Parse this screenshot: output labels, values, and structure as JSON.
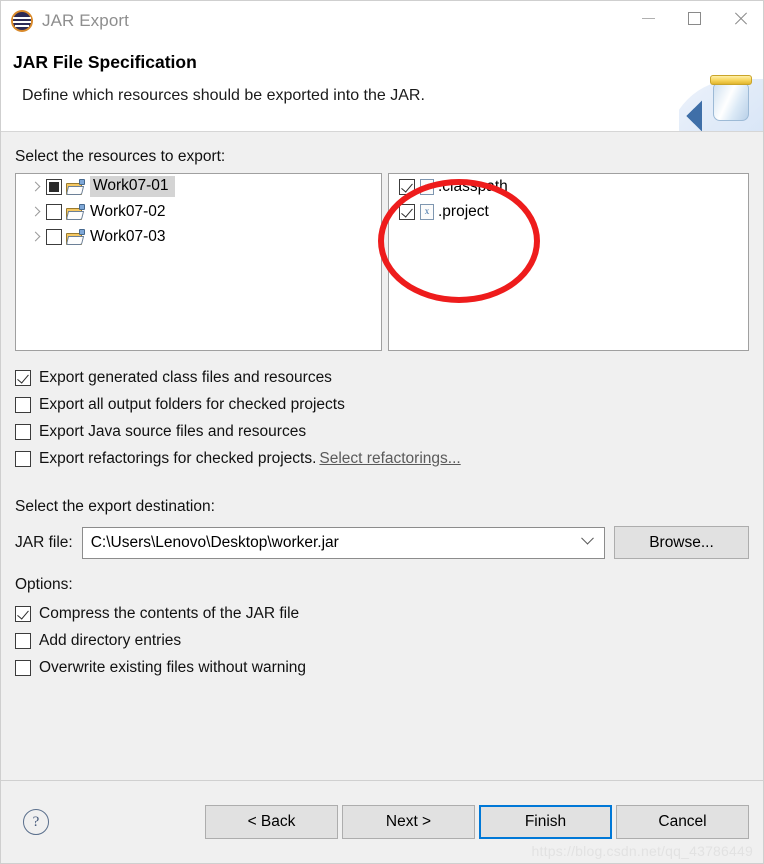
{
  "window": {
    "title": "JAR Export",
    "app_icon": "eclipse-icon",
    "controls": {
      "minimize": "minimize-icon",
      "maximize": "maximize-icon",
      "close": "close-icon"
    }
  },
  "header": {
    "title": "JAR File Specification",
    "subtitle": "Define which resources should be exported into the JAR.",
    "banner_icon": "jar-export-icon"
  },
  "resources": {
    "label": "Select the resources to export:",
    "tree": [
      {
        "label": "Work07-01",
        "check_state": "partial",
        "expandable": true,
        "selected": true,
        "icon": "project-folder-icon"
      },
      {
        "label": "Work07-02",
        "check_state": "unchecked",
        "expandable": true,
        "selected": false,
        "icon": "project-folder-icon"
      },
      {
        "label": "Work07-03",
        "check_state": "unchecked",
        "expandable": true,
        "selected": false,
        "icon": "project-folder-icon"
      }
    ],
    "files": [
      {
        "label": ".classpath",
        "check_state": "checked",
        "icon": "xml-file-icon",
        "icon_glyph": "x"
      },
      {
        "label": ".project",
        "check_state": "checked",
        "icon": "xml-file-icon",
        "icon_glyph": "x"
      }
    ],
    "annotation": {
      "shape": "ellipse",
      "color": "#ee1c1c"
    }
  },
  "export_options": [
    {
      "label": "Export generated class files and resources",
      "checked": true
    },
    {
      "label": "Export all output folders for checked projects",
      "checked": false
    },
    {
      "label": "Export Java source files and resources",
      "checked": false
    },
    {
      "label": "Export refactorings for checked projects.",
      "checked": false,
      "link": "Select refactorings..."
    }
  ],
  "destination": {
    "label": "Select the export destination:",
    "field_label": "JAR file:",
    "value": "C:\\Users\\Lenovo\\Desktop\\worker.jar",
    "placeholder": "",
    "browse_label": "Browse..."
  },
  "options": {
    "label": "Options:",
    "items": [
      {
        "label": "Compress the contents of the JAR file",
        "checked": true
      },
      {
        "label": "Add directory entries",
        "checked": false
      },
      {
        "label": "Overwrite existing files without warning",
        "checked": false
      }
    ]
  },
  "footer": {
    "help_icon": "help-icon",
    "help_glyph": "?",
    "buttons": [
      {
        "label": "< Back",
        "primary": false
      },
      {
        "label": "Next >",
        "primary": false
      },
      {
        "label": "Finish",
        "primary": true
      },
      {
        "label": "Cancel",
        "primary": false
      }
    ],
    "watermark": "https://blog.csdn.net/qq_43786449"
  },
  "colors": {
    "accent": "#0078d7",
    "annotation": "#ee1c1c",
    "dialog_bg": "#f0f0f0",
    "panel_bg": "#ffffff"
  }
}
